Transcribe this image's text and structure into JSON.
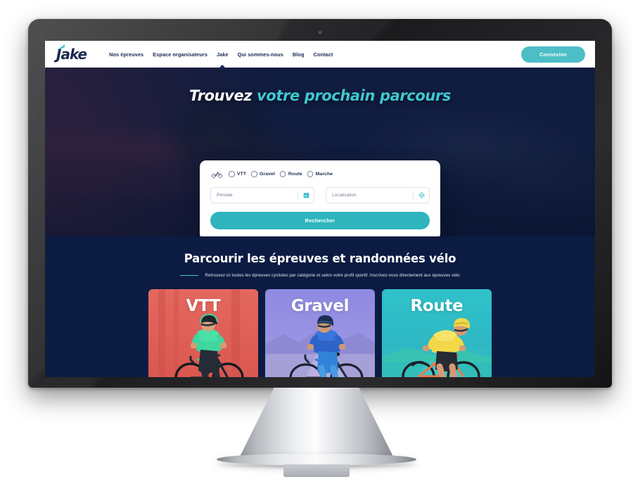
{
  "site": {
    "logo_text": "Jake",
    "logo_accent_color": "#3cc6c6"
  },
  "nav": {
    "items": [
      {
        "label": "Nos épreuves",
        "active": false
      },
      {
        "label": "Espace organisateurs",
        "active": false
      },
      {
        "label": "Jake",
        "active": true
      },
      {
        "label": "Qui sommes-nous",
        "active": false
      },
      {
        "label": "Blog",
        "active": false
      },
      {
        "label": "Contact",
        "active": false
      }
    ],
    "cta_label": "Connexion",
    "cta_color": "#4dbec6"
  },
  "hero": {
    "title_white": "Trouvez",
    "title_teal": "votre prochain parcours",
    "teal_color": "#3fc8cf",
    "background_color": "#0b1838"
  },
  "search": {
    "bike_icon": "bicycle-icon",
    "categories": [
      {
        "label": "VTT",
        "selected": false
      },
      {
        "label": "Gravel",
        "selected": false
      },
      {
        "label": "Route",
        "selected": false
      },
      {
        "label": "Marche",
        "selected": false
      }
    ],
    "period_field": {
      "placeholder": "Période",
      "value": "",
      "icon": "calendar-icon"
    },
    "location_field": {
      "placeholder": "Localisation",
      "value": "",
      "icon": "location-target-icon"
    },
    "submit_label": "Rechercher",
    "submit_color": "#2fb5bd"
  },
  "categories_section": {
    "title": "Parcourir les épreuves et randonnées vélo",
    "subtitle": "Retrouvez ici toutes les épreuves cyclistes par catégorie et selon votre profil sportif. Inscrivez-vous directement aux épreuves vélo",
    "dash_color": "#3fc8cf",
    "background_color": "#0c1b42",
    "cards": [
      {
        "label": "VTT",
        "color": "#d9574f",
        "jersey": "green",
        "alt": "Cycliste VTT en maillot vert"
      },
      {
        "label": "Gravel",
        "color": "#9a93e4",
        "jersey": "blue",
        "alt": "Cycliste gravel en maillot bleu"
      },
      {
        "label": "Route",
        "color": "#2eb8c4",
        "jersey": "yellow",
        "alt": "Cycliste route en maillot jaune"
      }
    ]
  },
  "device": {
    "type": "desktop-monitor",
    "webcam": "webcam-dot"
  }
}
